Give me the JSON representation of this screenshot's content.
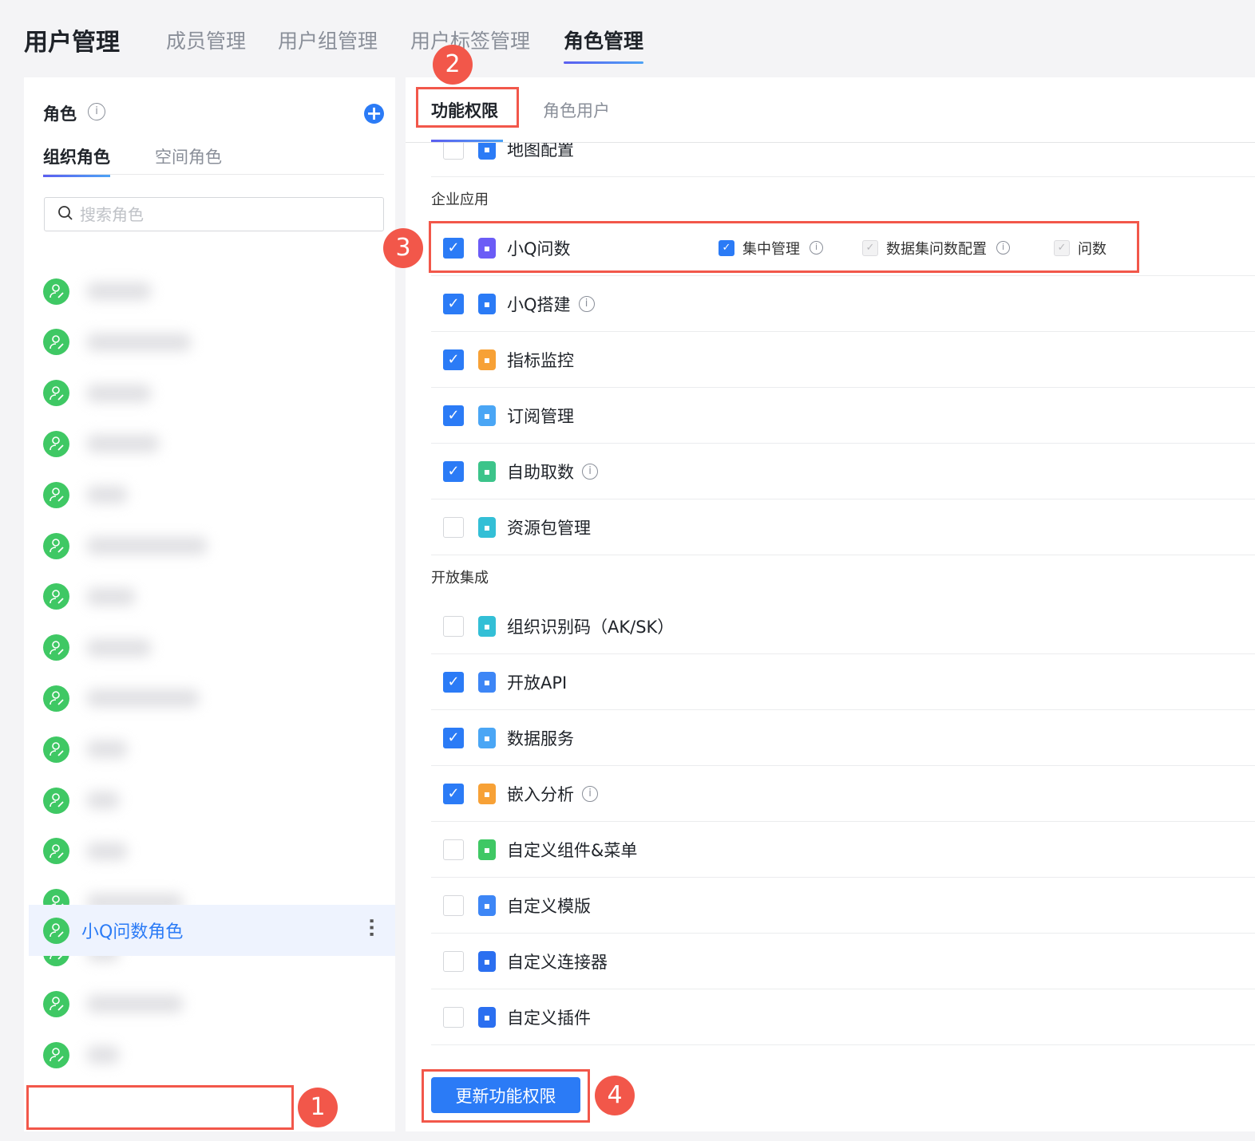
{
  "header": {
    "title": "用户管理",
    "tabs": [
      {
        "label": "成员管理"
      },
      {
        "label": "用户组管理"
      },
      {
        "label": "用户标签管理"
      },
      {
        "label": "角色管理"
      }
    ]
  },
  "left": {
    "title": "角色",
    "tabs": [
      "组织角色",
      "空间角色"
    ],
    "search_placeholder": "搜索角色",
    "selected_role": "小Q问数角色",
    "info_icon": "i"
  },
  "right": {
    "tabs": [
      "功能权限",
      "角色用户"
    ],
    "partial_row": {
      "label": "地图配置",
      "checked": false,
      "color": "#2b7bf6"
    },
    "sections": [
      {
        "title": "企业应用",
        "items": [
          {
            "label": "小Q问数",
            "checked": true,
            "color": "#6b5cf6",
            "info": false
          },
          {
            "label": "小Q搭建",
            "checked": true,
            "color": "#2b7bf6",
            "info": true
          },
          {
            "label": "指标监控",
            "checked": true,
            "color": "#f7a136",
            "info": false
          },
          {
            "label": "订阅管理",
            "checked": true,
            "color": "#4aa6f5",
            "info": false
          },
          {
            "label": "自助取数",
            "checked": true,
            "color": "#3cc48a",
            "info": true
          },
          {
            "label": "资源包管理",
            "checked": false,
            "color": "#33bfd6",
            "info": false
          }
        ]
      },
      {
        "title": "开放集成",
        "items": [
          {
            "label": "组织识别码（AK/SK）",
            "checked": false,
            "color": "#33bfd6",
            "info": false
          },
          {
            "label": "开放API",
            "checked": true,
            "color": "#3d86f6",
            "info": false
          },
          {
            "label": "数据服务",
            "checked": true,
            "color": "#4aa6f5",
            "info": false
          },
          {
            "label": "嵌入分析",
            "checked": true,
            "color": "#f7a136",
            "info": true
          },
          {
            "label": "自定义组件&菜单",
            "checked": false,
            "color": "#3fc864",
            "info": false
          },
          {
            "label": "自定义模版",
            "checked": false,
            "color": "#3d86f6",
            "info": false
          },
          {
            "label": "自定义连接器",
            "checked": false,
            "color": "#2b6ff0",
            "info": false
          },
          {
            "label": "自定义插件",
            "checked": false,
            "color": "#2b6ff0",
            "info": false
          }
        ]
      }
    ],
    "sub_permissions": [
      {
        "label": "集中管理",
        "checked": true,
        "disabled": false,
        "info": true
      },
      {
        "label": "数据集问数配置",
        "checked": true,
        "disabled": true,
        "info": true
      },
      {
        "label": "问数",
        "checked": true,
        "disabled": true,
        "info": false
      }
    ],
    "update_button": "更新功能权限"
  },
  "annotations": [
    "1",
    "2",
    "3",
    "4"
  ],
  "colors": {
    "accent": "#2b7bf6",
    "annotation": "#f2574a",
    "avatar": "#3fc864"
  }
}
